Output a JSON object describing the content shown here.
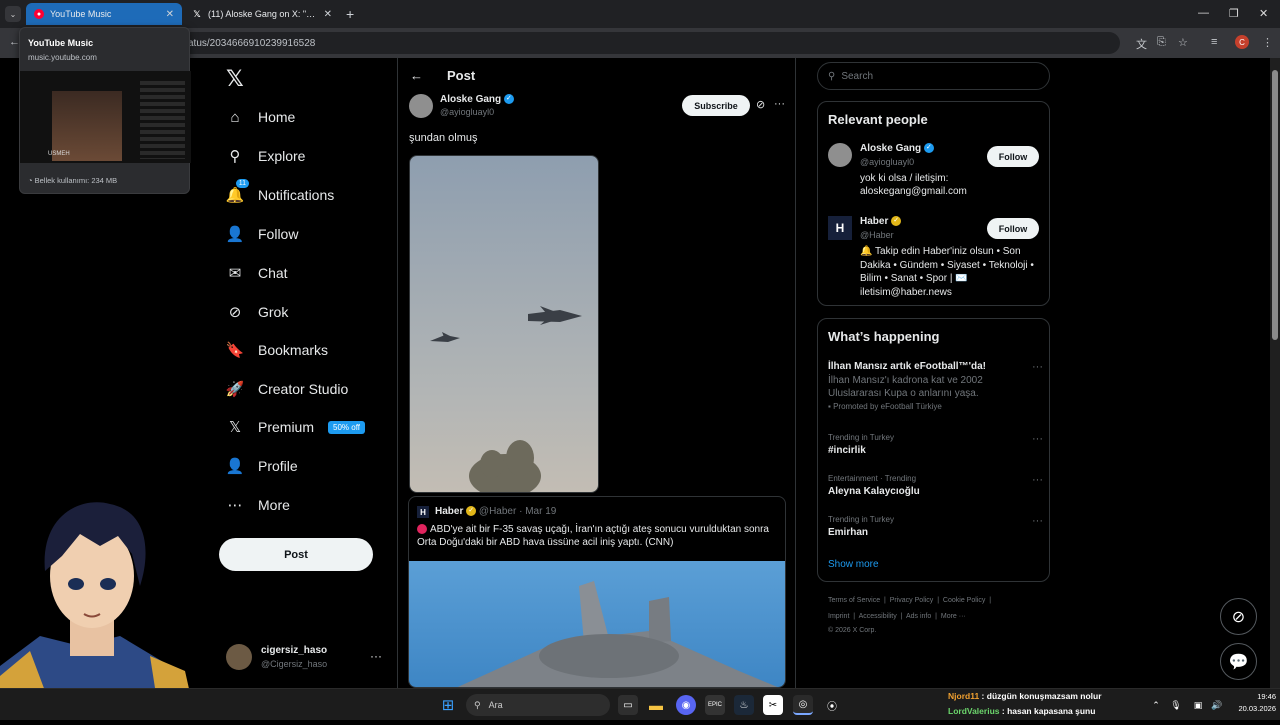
{
  "browser": {
    "tabs": [
      {
        "title": "YouTube Music",
        "active": true
      },
      {
        "title": "(11) Aloske Gang on X: \"şundan",
        "active": false
      }
    ],
    "url": "atus/2034666910239916528",
    "tab_tooltip": {
      "title": "YouTube Music",
      "domain": "music.youtube.com",
      "thumb_label": "USMEH",
      "memory": "Bellek kullanımı: 234 MB"
    },
    "profile_initial": "C"
  },
  "nav": {
    "items": [
      {
        "label": "Home",
        "icon": "home-icon",
        "glyph": "⌂"
      },
      {
        "label": "Explore",
        "icon": "search-icon",
        "glyph": "⚲"
      },
      {
        "label": "Notifications",
        "icon": "bell-icon",
        "glyph": "🔔",
        "badge": "11"
      },
      {
        "label": "Follow",
        "icon": "person-add-icon",
        "glyph": "👤"
      },
      {
        "label": "Chat",
        "icon": "mail-icon",
        "glyph": "✉"
      },
      {
        "label": "Grok",
        "icon": "grok-icon",
        "glyph": "⊘"
      },
      {
        "label": "Bookmarks",
        "icon": "bookmark-icon",
        "glyph": "🔖"
      },
      {
        "label": "Creator Studio",
        "icon": "rocket-icon",
        "glyph": "🚀"
      },
      {
        "label": "Premium",
        "icon": "x-logo-icon",
        "glyph": "𝕏",
        "tag": "50% off"
      },
      {
        "label": "Profile",
        "icon": "profile-icon",
        "glyph": "👤"
      },
      {
        "label": "More",
        "icon": "more-circle-icon",
        "glyph": "⋯"
      }
    ],
    "post_label": "Post",
    "account": {
      "name": "cigersiz_haso",
      "handle": "@Cigersiz_haso"
    }
  },
  "post": {
    "header": "Post",
    "author": {
      "name": "Aloske Gang",
      "handle": "@ayiogluayl0"
    },
    "subscribe_label": "Subscribe",
    "text": "şundan olmuş",
    "quote": {
      "name": "Haber",
      "handle": "@Haber",
      "date": "Mar 19",
      "text": "ABD'ye ait bir F-35 savaş uçağı, İran'ın açtığı ateş sonucu vurulduktan sonra Orta Doğu'daki bir ABD hava üssüne acil iniş yaptı. (CNN)"
    }
  },
  "right": {
    "search_placeholder": "Search",
    "relevant": {
      "title": "Relevant people",
      "people": [
        {
          "name": "Aloske Gang",
          "handle": "@ayiogluayl0",
          "bio": "yok ki olsa / iletişim: aloskegang@gmail.com",
          "follow": "Follow"
        },
        {
          "name": "Haber",
          "handle": "@Haber",
          "bio": "🔔 Takip edin Haber'iniz olsun • Son Dakika • Gündem • Siyaset • Teknoloji • Bilim • Sanat • Spor | ✉️ iletisim@haber.news",
          "follow": "Follow"
        }
      ]
    },
    "happening": {
      "title": "What’s happening",
      "promo": {
        "title": "İlhan Mansız artık eFootball™'da!",
        "body": "İlhan Mansız'ı kadrona kat ve 2002 Uluslararası Kupa o anlarını yaşa.",
        "promoted": "Promoted by eFootball Türkiye"
      },
      "trends": [
        {
          "meta": "Trending in Turkey",
          "name": "#incirlik"
        },
        {
          "meta": "Entertainment · Trending",
          "name": "Aleyna Kalaycıoğlu"
        },
        {
          "meta": "Trending in Turkey",
          "name": "Emirhan"
        }
      ],
      "show_more": "Show more"
    },
    "footer": {
      "row1": [
        "Terms of Service",
        "Privacy Policy",
        "Cookie Policy"
      ],
      "row2": [
        "Imprint",
        "Accessibility",
        "Ads info",
        "More ···"
      ],
      "copyright": "© 2026 X Corp."
    }
  },
  "taskbar": {
    "search_label": "Ara",
    "chat": [
      {
        "user": "Njord11",
        "text": "düzgün konuşmazsam nolur",
        "color": "#f0a030"
      },
      {
        "user": "LordValerius",
        "text": "hasan kapasana şunu",
        "color": "#6cd66c"
      }
    ],
    "time": "19:46",
    "date": "20.03.2026"
  }
}
